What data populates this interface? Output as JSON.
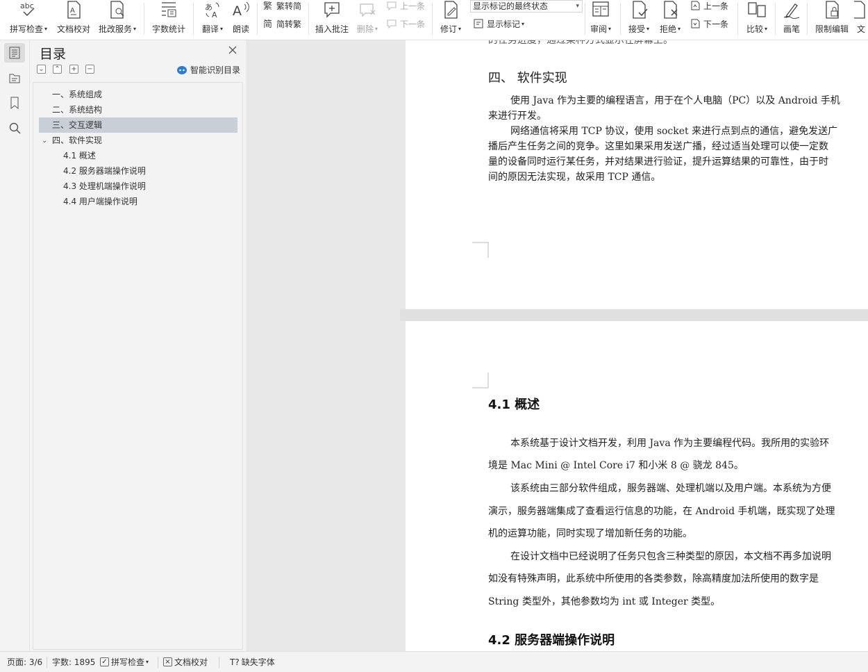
{
  "ribbon": {
    "spell_check": "拼写检查",
    "doc_proofread": "文档校对",
    "review_service": "批改服务",
    "word_count": "字数统计",
    "translate": "翻译",
    "read_aloud": "朗读",
    "trad_to_simp": "繁转简",
    "simp_to_trad": "简转繁",
    "insert_comment": "插入批注",
    "delete": "删除",
    "prev_comment": "上一条",
    "next_comment": "下一条",
    "track_changes": "修订",
    "display_status": "显示标记的最终状态",
    "show_markup": "显示标记",
    "review": "审阅",
    "accept": "接受",
    "reject": "拒绝",
    "prev_change": "上一条",
    "next_change": "下一条",
    "compare": "比较",
    "ink": "画笔",
    "restrict_edit": "限制编辑",
    "doc_cut": "文"
  },
  "nav": {
    "title": "目录",
    "smart_toc": "智能识别目录",
    "items": [
      {
        "label": "一、系统组成"
      },
      {
        "label": "二、系统结构"
      },
      {
        "label": "三、交互逻辑"
      },
      {
        "label": "四、软件实现"
      },
      {
        "label": "4.1 概述"
      },
      {
        "label": "4.2 服务器端操作说明"
      },
      {
        "label": "4.3 处理机端操作说明"
      },
      {
        "label": "4.4 用户端操作说明"
      }
    ]
  },
  "document": {
    "page1": {
      "top_cut": "的任务进度，通过某种方式显示在屏幕上。",
      "heading": "四、 软件实现",
      "lines": [
        "使用 Java 作为主要的编程语言，用于在个人电脑（PC）以及 Android 手机",
        "来进行开发。",
        "网络通信将采用 TCP 协议，使用 socket 来进行点到点的通信，避免发送广",
        "播后产生任务之间的竞争。这里如果采用发送广播，经过适当处理可以使一定数",
        "量的设备同时运行某任务，并对结果进行验证，提升运算结果的可靠性，由于时",
        "间的原因无法实现，故采用 TCP 通信。"
      ]
    },
    "page2": {
      "heading1": "4.1 概述",
      "lines": [
        "本系统基于设计文档开发，利用 Java 作为主要编程代码。我所用的实验环",
        "境是 Mac Mini @ Intel Core i7 和小米 8 @ 骁龙 845。",
        "该系统由三部分软件组成，服务器端、处理机端以及用户端。本系统为方便",
        "演示，服务器端集成了查看运行信息的功能，在 Android 手机端，既实现了处理",
        "机的运算功能，同时实现了增加新任务的功能。",
        "在设计文档中已经说明了任务只包含三种类型的原因，本文档不再多加说明",
        "如没有特殊声明，此系统中所使用的各类参数，除高精度加法所使用的数字是",
        "String 类型外，其他参数均为 int 或 Integer 类型。"
      ],
      "heading2": "4.2 服务器端操作说明"
    }
  },
  "statusbar": {
    "page": "页面: 3/6",
    "word_count": "字数: 1895",
    "spell_check": "拼写检查",
    "doc_proofread": "文档校对",
    "missing_font": "缺失字体"
  },
  "colors": {
    "toc_selected": "#c8cfd6",
    "accent_blue": "#2b7cd3",
    "pane_bg": "#f3f3f3"
  }
}
